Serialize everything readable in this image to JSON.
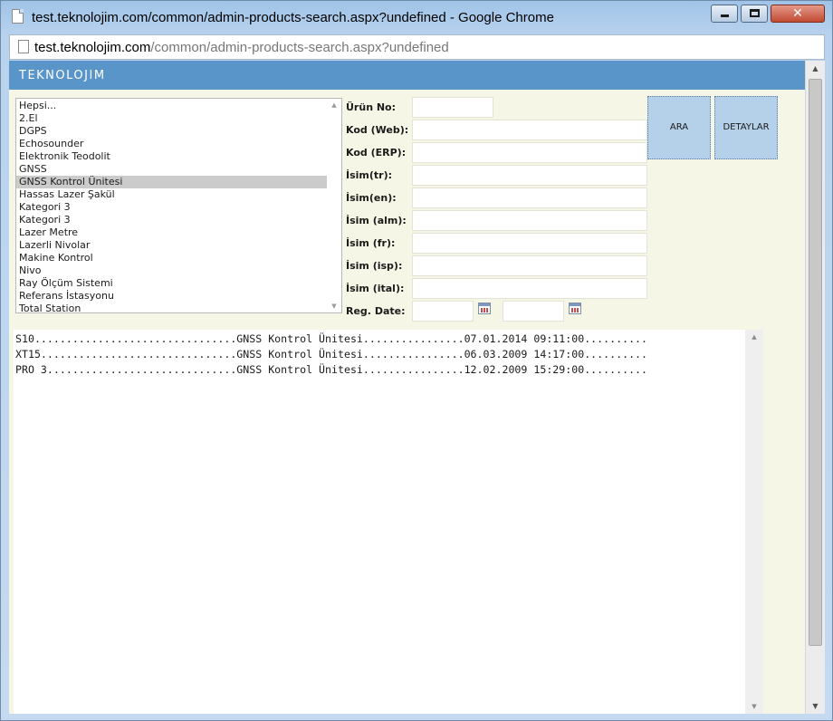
{
  "window": {
    "title": "test.teknolojim.com/common/admin-products-search.aspx?undefined - Google Chrome",
    "close_glyph": "✕"
  },
  "address": {
    "host": "test.teknolojim.com",
    "path": "/common/admin-products-search.aspx?undefined"
  },
  "header": {
    "logo": "TEKNOLOJIM",
    "accent_color": "#5a95c9"
  },
  "categories": {
    "items": [
      "Hepsi...",
      "2.El",
      "DGPS",
      "Echosounder",
      "Elektronik Teodolit",
      "GNSS",
      "GNSS Kontrol Ünitesi",
      "Hassas Lazer Şakül",
      "Kategori 3",
      "Kategori 3",
      "Lazer Metre",
      "Lazerli Nivolar",
      "Makine Kontrol",
      "Nivo",
      "Ray Ölçüm Sistemi",
      "Referans İstasyonu",
      "Total Station"
    ],
    "selected": "GNSS Kontrol Ünitesi"
  },
  "form": {
    "urun_no": {
      "label": "Ürün No:",
      "value": ""
    },
    "kod_web": {
      "label": "Kod (Web):",
      "value": ""
    },
    "kod_erp": {
      "label": "Kod (ERP):",
      "value": ""
    },
    "isim_tr": {
      "label": "İsim(tr):",
      "value": ""
    },
    "isim_en": {
      "label": "İsim(en):",
      "value": ""
    },
    "isim_alm": {
      "label": "İsim (alm):",
      "value": ""
    },
    "isim_fr": {
      "label": "İsim (fr):",
      "value": ""
    },
    "isim_isp": {
      "label": "İsim (isp):",
      "value": ""
    },
    "isim_ital": {
      "label": "İsim (ital):",
      "value": ""
    },
    "reg_date": {
      "label": "Reg. Date:",
      "from": "",
      "to": ""
    }
  },
  "buttons": {
    "search": "ARA",
    "details": "DETAYLAR"
  },
  "results": {
    "lines": [
      "S10................................GNSS Kontrol Ünitesi................07.01.2014 09:11:00..........",
      "XT15...............................GNSS Kontrol Ünitesi................06.03.2009 14:17:00..........",
      "PRO 3..............................GNSS Kontrol Ünitesi................12.02.2009 15:29:00.........."
    ]
  },
  "icons": {
    "page": "page-icon",
    "calendar": "calendar-icon"
  }
}
